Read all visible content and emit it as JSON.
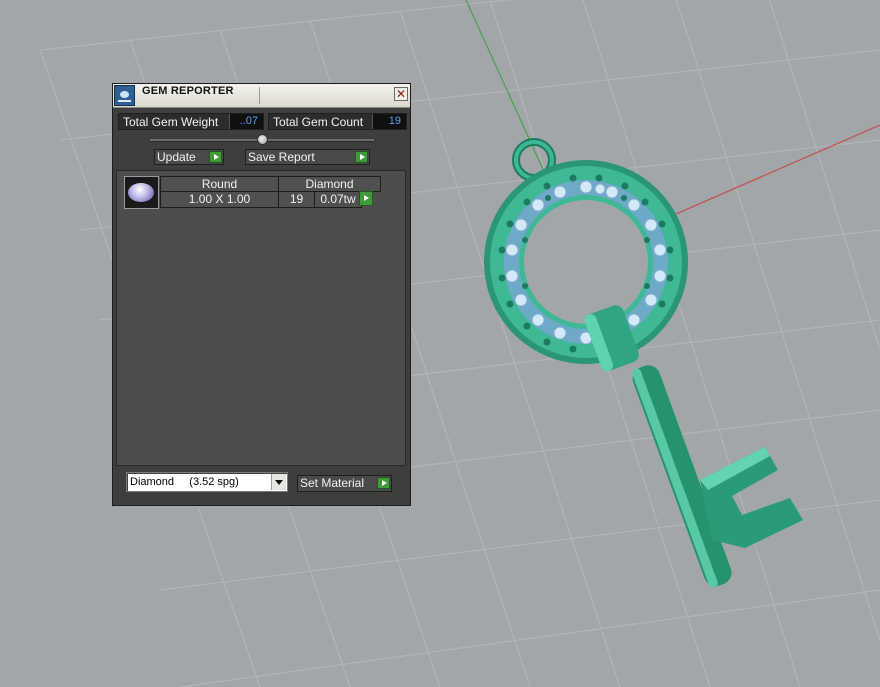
{
  "window": {
    "title": "GEM REPORTER",
    "close_glyph": "✕"
  },
  "stats": {
    "weight_label": "Total Gem Weight",
    "weight_value": "..07",
    "count_label": "Total Gem Count",
    "count_value": "19"
  },
  "toolbar": {
    "update_label": "Update",
    "save_label": "Save Report"
  },
  "gem_table": {
    "rows": [
      {
        "thumbnail_icon": "round-gem-icon",
        "shape": "Round",
        "material": "Diamond",
        "size": "1.00 X 1.00",
        "count": "19",
        "weight": "0.07tw"
      }
    ]
  },
  "material_picker": {
    "selected": "Diamond     (3.52 spg)",
    "set_label": "Set Material"
  },
  "colors": {
    "panel_bg": "#3e3e3e",
    "list_bg": "#4d4d4d",
    "value_text": "#5aa3ff",
    "play_green": "#3f9a3a",
    "viewport_bg": "#a3a6a9",
    "grid_line": "#b3b6b9",
    "model_color": "#2f9b7c",
    "stone_color": "#bdd9ee",
    "x_axis": "#c05050",
    "y_axis": "#4aa04a"
  },
  "icons": {
    "app": "gem-reporter-app-icon",
    "close": "close-icon",
    "play": "play-arrow-icon",
    "dropdown": "chevron-down-icon",
    "slider": "slider-knob-icon"
  }
}
